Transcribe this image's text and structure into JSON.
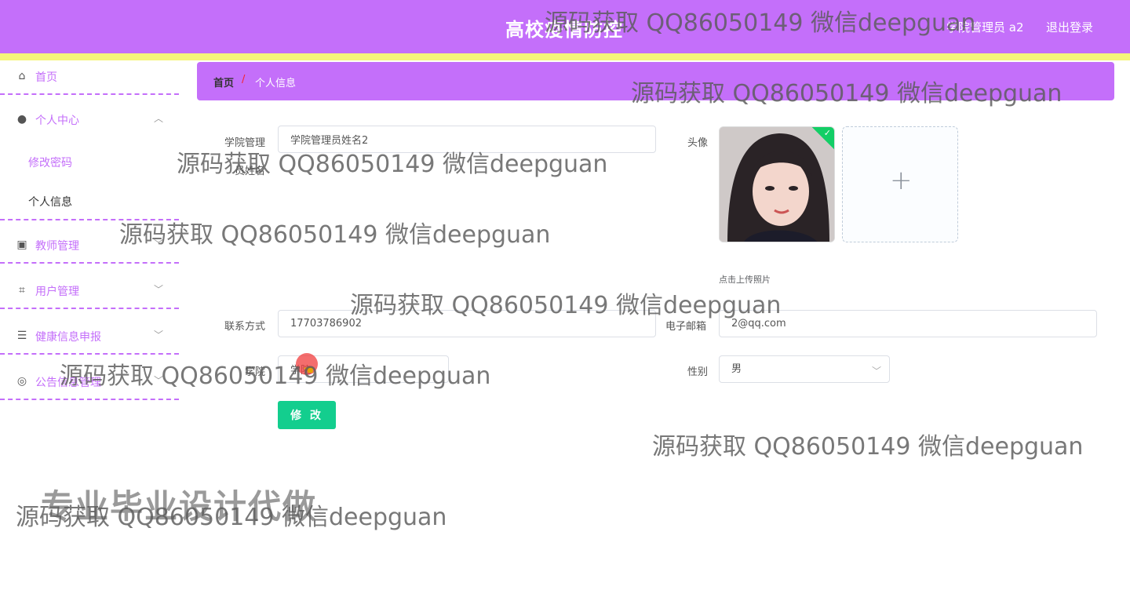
{
  "header": {
    "title": "高校疫情防控",
    "user": "学院管理员 a2",
    "logout": "退出登录"
  },
  "sidebar": {
    "home": "首页",
    "personal_center": "个人中心",
    "change_password": "修改密码",
    "personal_info": "个人信息",
    "teacher_mgmt": "教师管理",
    "user_mgmt": "用户管理",
    "health_report": "健康信息申报",
    "notice_mgmt": "公告信息管理"
  },
  "breadcrumb": {
    "home": "首页",
    "separator": "/",
    "current": "个人信息"
  },
  "form": {
    "name_label_line1": "学院管理",
    "name_label_line2": "员姓名",
    "name_value": "学院管理员姓名2",
    "avatar_label": "头像",
    "upload_tip": "点击上传照片",
    "phone_label": "联系方式",
    "phone_value": "17703786902",
    "email_label": "电子邮箱",
    "email_value": "2@qq.com",
    "college_label": "学院",
    "college_value": "学院",
    "gender_label": "性别",
    "gender_value": "男",
    "submit": "修 改"
  },
  "watermark_text": "源码获取 QQ86050149 微信deepguan",
  "promo_text": "专业毕业设计代做",
  "colors": {
    "header_bg": "#c46ffa",
    "stripe": "#f5f57a",
    "accent_button": "#13ce8e"
  }
}
